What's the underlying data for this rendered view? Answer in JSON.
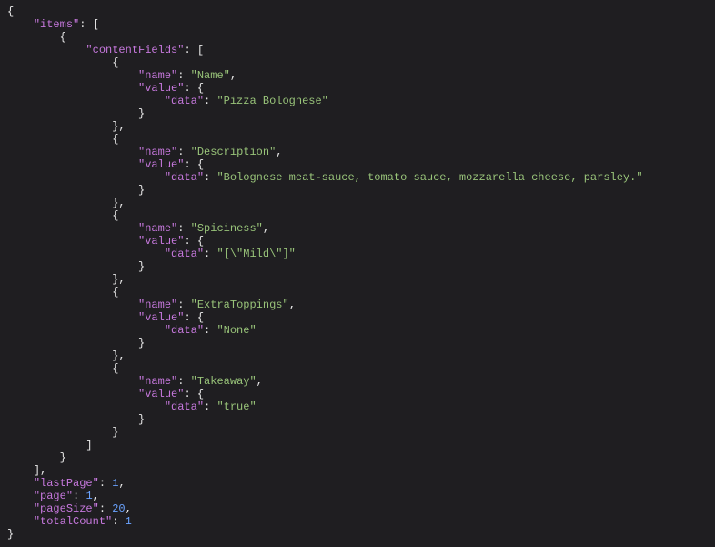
{
  "tokens": [
    {
      "indent": 0,
      "parts": [
        {
          "c": "p",
          "t": "{"
        }
      ]
    },
    {
      "indent": 1,
      "parts": [
        {
          "c": "k",
          "t": "\"items\""
        },
        {
          "c": "p",
          "t": ": ["
        }
      ]
    },
    {
      "indent": 2,
      "parts": [
        {
          "c": "p",
          "t": "{"
        }
      ]
    },
    {
      "indent": 3,
      "parts": [
        {
          "c": "k",
          "t": "\"contentFields\""
        },
        {
          "c": "p",
          "t": ": ["
        }
      ]
    },
    {
      "indent": 4,
      "parts": [
        {
          "c": "p",
          "t": "{"
        }
      ]
    },
    {
      "indent": 5,
      "parts": [
        {
          "c": "k",
          "t": "\"name\""
        },
        {
          "c": "p",
          "t": ": "
        },
        {
          "c": "s",
          "t": "\"Name\""
        },
        {
          "c": "p",
          "t": ","
        }
      ]
    },
    {
      "indent": 5,
      "parts": [
        {
          "c": "k",
          "t": "\"value\""
        },
        {
          "c": "p",
          "t": ": {"
        }
      ]
    },
    {
      "indent": 6,
      "parts": [
        {
          "c": "k",
          "t": "\"data\""
        },
        {
          "c": "p",
          "t": ": "
        },
        {
          "c": "s",
          "t": "\"Pizza Bolognese\""
        }
      ]
    },
    {
      "indent": 5,
      "parts": [
        {
          "c": "p",
          "t": "}"
        }
      ]
    },
    {
      "indent": 4,
      "parts": [
        {
          "c": "p",
          "t": "},"
        }
      ]
    },
    {
      "indent": 4,
      "parts": [
        {
          "c": "p",
          "t": "{"
        }
      ]
    },
    {
      "indent": 5,
      "parts": [
        {
          "c": "k",
          "t": "\"name\""
        },
        {
          "c": "p",
          "t": ": "
        },
        {
          "c": "s",
          "t": "\"Description\""
        },
        {
          "c": "p",
          "t": ","
        }
      ]
    },
    {
      "indent": 5,
      "parts": [
        {
          "c": "k",
          "t": "\"value\""
        },
        {
          "c": "p",
          "t": ": {"
        }
      ]
    },
    {
      "indent": 6,
      "parts": [
        {
          "c": "k",
          "t": "\"data\""
        },
        {
          "c": "p",
          "t": ": "
        },
        {
          "c": "s",
          "t": "\"Bolognese meat-sauce, tomato sauce, mozzarella cheese, parsley.\""
        }
      ]
    },
    {
      "indent": 5,
      "parts": [
        {
          "c": "p",
          "t": "}"
        }
      ]
    },
    {
      "indent": 4,
      "parts": [
        {
          "c": "p",
          "t": "},"
        }
      ]
    },
    {
      "indent": 4,
      "parts": [
        {
          "c": "p",
          "t": "{"
        }
      ]
    },
    {
      "indent": 5,
      "parts": [
        {
          "c": "k",
          "t": "\"name\""
        },
        {
          "c": "p",
          "t": ": "
        },
        {
          "c": "s",
          "t": "\"Spiciness\""
        },
        {
          "c": "p",
          "t": ","
        }
      ]
    },
    {
      "indent": 5,
      "parts": [
        {
          "c": "k",
          "t": "\"value\""
        },
        {
          "c": "p",
          "t": ": {"
        }
      ]
    },
    {
      "indent": 6,
      "parts": [
        {
          "c": "k",
          "t": "\"data\""
        },
        {
          "c": "p",
          "t": ": "
        },
        {
          "c": "s",
          "t": "\"[\\\"Mild\\\"]\""
        }
      ]
    },
    {
      "indent": 5,
      "parts": [
        {
          "c": "p",
          "t": "}"
        }
      ]
    },
    {
      "indent": 4,
      "parts": [
        {
          "c": "p",
          "t": "},"
        }
      ]
    },
    {
      "indent": 4,
      "parts": [
        {
          "c": "p",
          "t": "{"
        }
      ]
    },
    {
      "indent": 5,
      "parts": [
        {
          "c": "k",
          "t": "\"name\""
        },
        {
          "c": "p",
          "t": ": "
        },
        {
          "c": "s",
          "t": "\"ExtraToppings\""
        },
        {
          "c": "p",
          "t": ","
        }
      ]
    },
    {
      "indent": 5,
      "parts": [
        {
          "c": "k",
          "t": "\"value\""
        },
        {
          "c": "p",
          "t": ": {"
        }
      ]
    },
    {
      "indent": 6,
      "parts": [
        {
          "c": "k",
          "t": "\"data\""
        },
        {
          "c": "p",
          "t": ": "
        },
        {
          "c": "s",
          "t": "\"None\""
        }
      ]
    },
    {
      "indent": 5,
      "parts": [
        {
          "c": "p",
          "t": "}"
        }
      ]
    },
    {
      "indent": 4,
      "parts": [
        {
          "c": "p",
          "t": "},"
        }
      ]
    },
    {
      "indent": 4,
      "parts": [
        {
          "c": "p",
          "t": "{"
        }
      ]
    },
    {
      "indent": 5,
      "parts": [
        {
          "c": "k",
          "t": "\"name\""
        },
        {
          "c": "p",
          "t": ": "
        },
        {
          "c": "s",
          "t": "\"Takeaway\""
        },
        {
          "c": "p",
          "t": ","
        }
      ]
    },
    {
      "indent": 5,
      "parts": [
        {
          "c": "k",
          "t": "\"value\""
        },
        {
          "c": "p",
          "t": ": {"
        }
      ]
    },
    {
      "indent": 6,
      "parts": [
        {
          "c": "k",
          "t": "\"data\""
        },
        {
          "c": "p",
          "t": ": "
        },
        {
          "c": "s",
          "t": "\"true\""
        }
      ]
    },
    {
      "indent": 5,
      "parts": [
        {
          "c": "p",
          "t": "}"
        }
      ]
    },
    {
      "indent": 4,
      "parts": [
        {
          "c": "p",
          "t": "}"
        }
      ]
    },
    {
      "indent": 3,
      "parts": [
        {
          "c": "p",
          "t": "]"
        }
      ]
    },
    {
      "indent": 2,
      "parts": [
        {
          "c": "p",
          "t": "}"
        }
      ]
    },
    {
      "indent": 1,
      "parts": [
        {
          "c": "p",
          "t": "],"
        }
      ]
    },
    {
      "indent": 1,
      "parts": [
        {
          "c": "k",
          "t": "\"lastPage\""
        },
        {
          "c": "p",
          "t": ": "
        },
        {
          "c": "n",
          "t": "1"
        },
        {
          "c": "p",
          "t": ","
        }
      ]
    },
    {
      "indent": 1,
      "parts": [
        {
          "c": "k",
          "t": "\"page\""
        },
        {
          "c": "p",
          "t": ": "
        },
        {
          "c": "n",
          "t": "1"
        },
        {
          "c": "p",
          "t": ","
        }
      ]
    },
    {
      "indent": 1,
      "parts": [
        {
          "c": "k",
          "t": "\"pageSize\""
        },
        {
          "c": "p",
          "t": ": "
        },
        {
          "c": "n",
          "t": "20"
        },
        {
          "c": "p",
          "t": ","
        }
      ]
    },
    {
      "indent": 1,
      "parts": [
        {
          "c": "k",
          "t": "\"totalCount\""
        },
        {
          "c": "p",
          "t": ": "
        },
        {
          "c": "n",
          "t": "1"
        }
      ]
    },
    {
      "indent": 0,
      "parts": [
        {
          "c": "p",
          "t": "}"
        }
      ]
    }
  ],
  "indentUnit": "    "
}
